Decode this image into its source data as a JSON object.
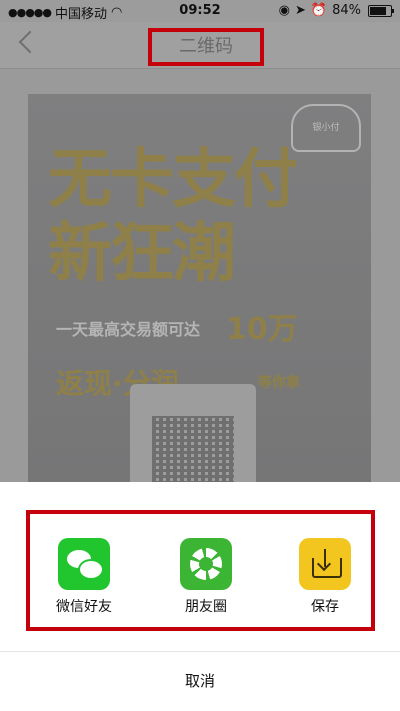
{
  "status_bar": {
    "carrier": "中国移动",
    "time": "09:52",
    "battery": "84%"
  },
  "nav": {
    "title": "二维码"
  },
  "poster": {
    "logo_text": "银小付",
    "headline_1": "无卡支付",
    "headline_2": "新狂潮",
    "promo_line": "一天最高交易额可达",
    "promo_amount": "10万",
    "promo_2": "返现·分润",
    "promo_2_tail": "等你拿"
  },
  "share": {
    "items": [
      {
        "label": "微信好友",
        "icon": "wechat-icon",
        "color": "#21c62f"
      },
      {
        "label": "朋友圈",
        "icon": "moments-icon",
        "color": "#3cb534"
      },
      {
        "label": "保存",
        "icon": "save-icon",
        "color": "#f3c51f"
      }
    ],
    "cancel": "取消"
  },
  "highlight_color": "#c4000b"
}
